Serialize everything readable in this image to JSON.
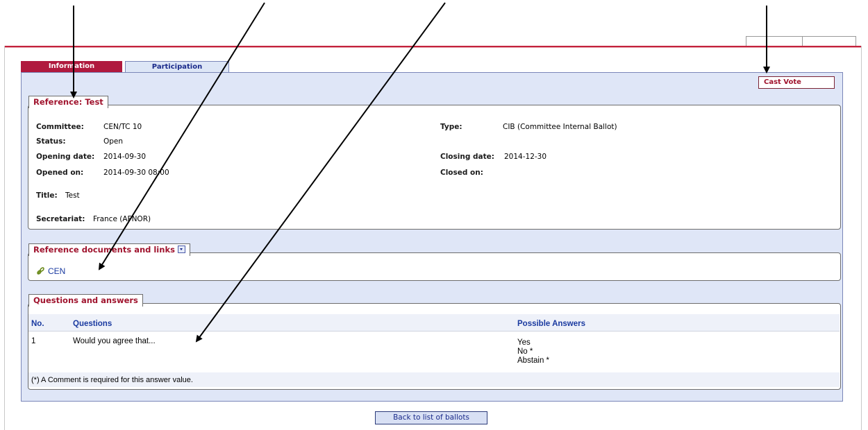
{
  "tabs": [
    {
      "label": "Information",
      "active": true
    },
    {
      "label": "Participation",
      "active": false
    }
  ],
  "cast_vote_label": "Cast Vote",
  "reference": {
    "legend": "Reference: Test",
    "committee_label": "Committee:",
    "committee_value": "CEN/TC 10",
    "status_label": "Status:",
    "status_value": "Open",
    "opening_date_label": "Opening date:",
    "opening_date_value": "2014-09-30",
    "opened_on_label": "Opened on:",
    "opened_on_value": "2014-09-30 08:00",
    "type_label": "Type:",
    "type_value": "CIB  (Committee Internal Ballot)",
    "closing_date_label": "Closing date:",
    "closing_date_value": "2014-12-30",
    "closed_on_label": "Closed on:",
    "closed_on_value": "",
    "title_label": "Title:",
    "title_value": "Test",
    "secretariat_label": "Secretariat:",
    "secretariat_value": "France (AFNOR)"
  },
  "documents": {
    "legend": "Reference documents and links",
    "links": [
      {
        "label": "CEN",
        "icon": "link-icon"
      }
    ]
  },
  "qa": {
    "legend": "Questions and answers",
    "columns": {
      "no": "No.",
      "questions": "Questions",
      "answers": "Possible Answers"
    },
    "rows": [
      {
        "no": "1",
        "question": "Would you agree that...",
        "answers": [
          "Yes",
          "No *",
          "Abstain *"
        ]
      }
    ],
    "footnote": "(*) A Comment is required for this answer value."
  },
  "back_label": "Back to list of ballots",
  "colors": {
    "accent": "#b0193e",
    "panel": "#dfe6f7",
    "link": "#1a3aa0"
  }
}
